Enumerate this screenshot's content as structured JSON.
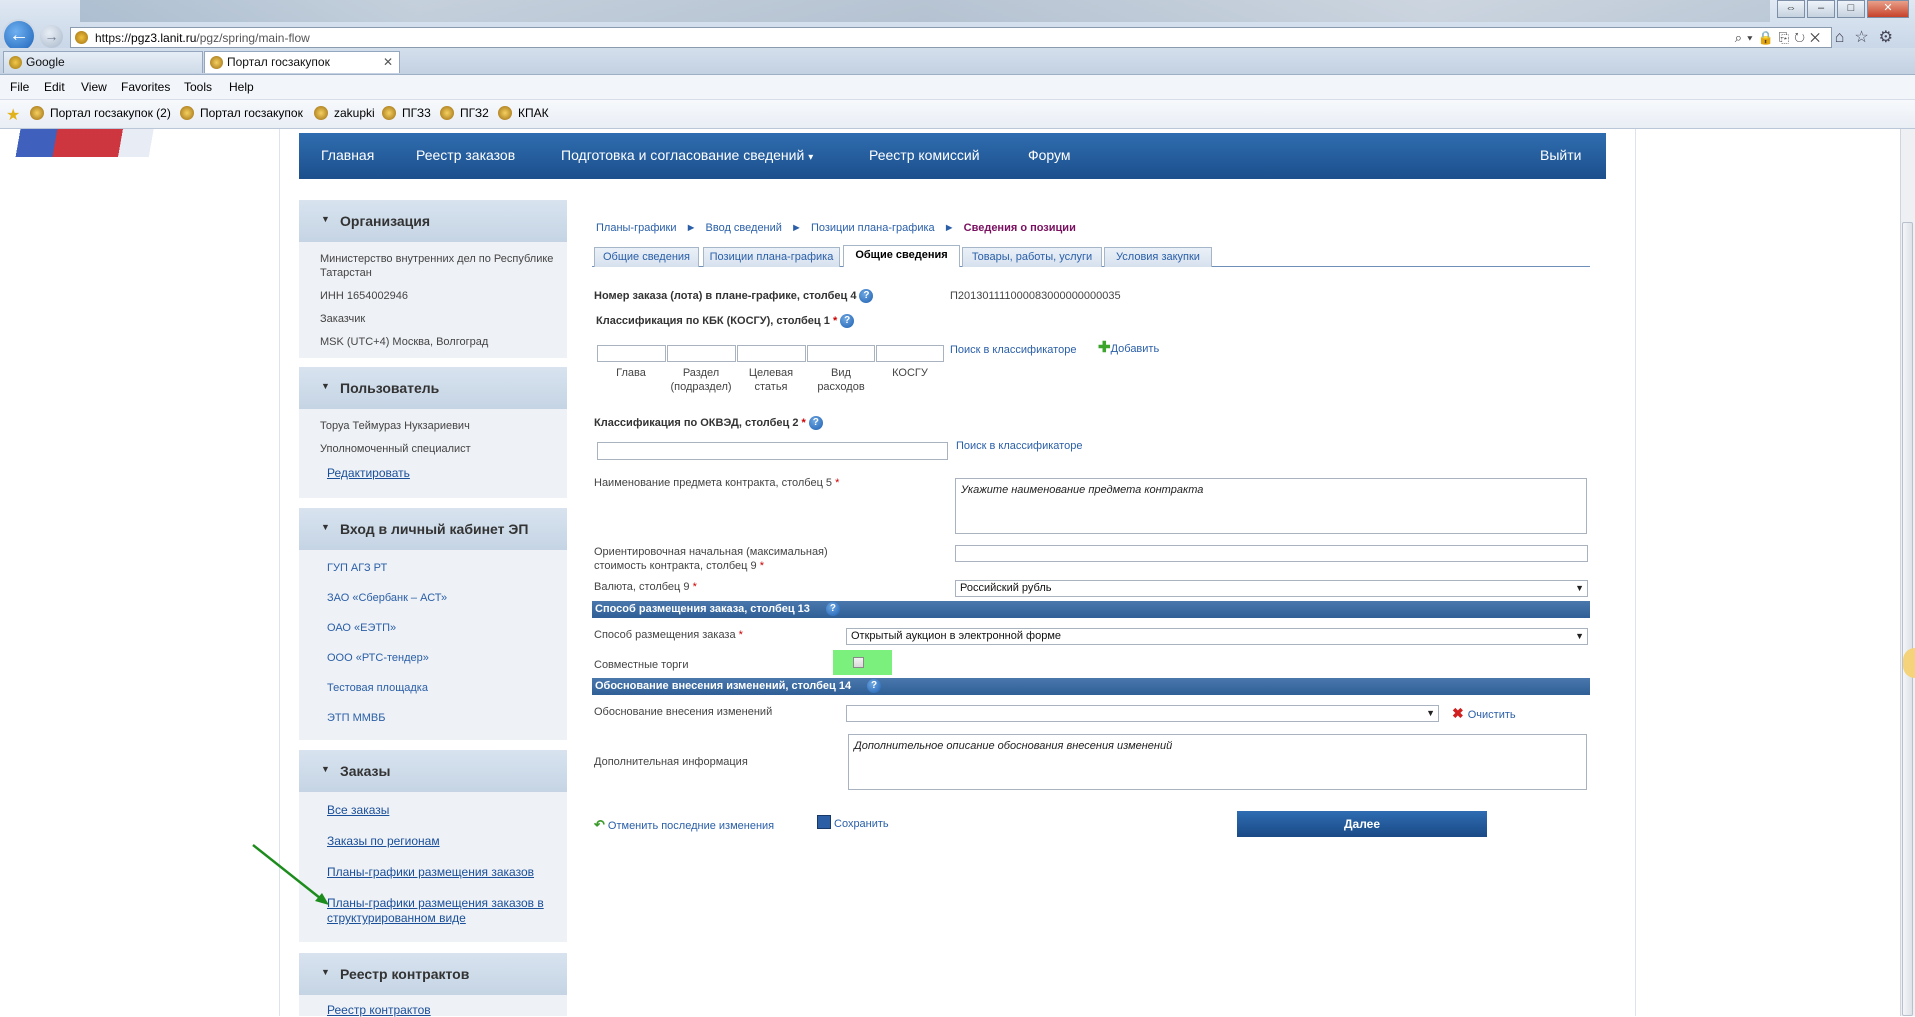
{
  "browser": {
    "url_prefix": "https://",
    "url_host": "pgz3.lanit.ru",
    "url_path": "/pgz/spring/main-flow",
    "tabs": [
      {
        "label": "Google"
      },
      {
        "label": "Портал госзакупок"
      }
    ],
    "menu": [
      "File",
      "Edit",
      "View",
      "Favorites",
      "Tools",
      "Help"
    ],
    "favorites": [
      "Портал госзакупок (2)",
      "Портал госзакупок",
      "zakupki",
      "ПГЗ3",
      "ПГЗ2",
      "КПАК"
    ]
  },
  "nav": {
    "items": [
      "Главная",
      "Реестр заказов",
      "Подготовка и согласование сведений",
      "Реестр комиссий",
      "Форум"
    ],
    "dropdown_marker": "▾",
    "logout": "Выйти"
  },
  "sidebar": {
    "org": {
      "title": "Организация",
      "name": "Министерство внутренних дел по Республике Татарстан",
      "inn": "ИНН 1654002946",
      "role": "Заказчик",
      "timezone": "MSK (UTC+4) Москва, Волгоград"
    },
    "user": {
      "title": "Пользователь",
      "name": "Торуа Теймураз Нукзариевич",
      "role": "Уполномоченный специалист",
      "edit_link": "Редактировать"
    },
    "ep": {
      "title": "Вход в личный кабинет ЭП",
      "links": [
        "ГУП АГЗ РТ",
        "ЗАО «Сбербанк – АСТ»",
        "ОАО «ЕЭТП»",
        "ООО «РТС-тендер»",
        "Тестовая площадка",
        "ЭТП ММВБ"
      ]
    },
    "orders": {
      "title": "Заказы",
      "links": [
        "Все заказы",
        "Заказы по регионам",
        "Планы-графики размещения заказов",
        "Планы-графики размещения заказов в структурированном виде"
      ]
    },
    "contracts": {
      "title": "Реестр контрактов",
      "links": [
        "Реестр контрактов"
      ]
    }
  },
  "breadcrumb": {
    "items": [
      "Планы-графики",
      "Ввод сведений",
      "Позиции плана-графика"
    ],
    "separator": "►",
    "current": "Сведения о позиции"
  },
  "form_tabs": [
    {
      "label": "Общие сведения",
      "active": false
    },
    {
      "label": "Позиции плана-графика",
      "active": false
    },
    {
      "label": "Общие сведения",
      "active": true
    },
    {
      "label": "Товары, работы, услуги",
      "active": false
    },
    {
      "label": "Условия закупки",
      "active": false
    }
  ],
  "form": {
    "order_number_label": "Номер заказа (лота) в плане-графике, столбец 4",
    "order_number_value": "П201301111000083000000000035",
    "help_glyph": "?",
    "required_mark": "*",
    "kbk_label": "Классификация по КБК (КОСГУ), столбец 1",
    "kbk_fields": [
      "Глава",
      "Раздел (подраздел)",
      "Целевая статья",
      "Вид расходов",
      "КОСГУ"
    ],
    "search_classifier": "Поиск в классификаторе",
    "add_label": "Добавить",
    "okved_label": "Классификация по ОКВЭД, столбец 2",
    "subject_label": "Наименование предмета контракта, столбец 5",
    "subject_placeholder": "Укажите наименование предмета контракта",
    "price_label": "Ориентировочная начальная (максимальная) стоимость контракта, столбец 9",
    "currency_label": "Валюта, столбец 9",
    "currency_value": "Российский рубль",
    "placement_section": "Способ размещения заказа, столбец 13",
    "placement_label": "Способ размещения заказа",
    "placement_value": "Открытый аукцион в электронной форме",
    "joint_label": "Совместные торги",
    "changes_section": "Обоснование внесения изменений, столбец 14",
    "changes_label": "Обоснование внесения изменений",
    "clear_label": "Очистить",
    "extra_label": "Дополнительная информация",
    "extra_placeholder": "Дополнительное описание обоснования внесения изменений",
    "undo_label": "Отменить последние изменения",
    "save_label": "Сохранить",
    "next_label": "Далее"
  },
  "colors": {
    "nav_bg": "#1c4f8c",
    "section_bar": "#2f5f96",
    "link": "#2a5fa8",
    "breadcrumb_current": "#7a1060",
    "highlight": "#7cf07c",
    "annotation_arrow": "#1c8c1c"
  }
}
